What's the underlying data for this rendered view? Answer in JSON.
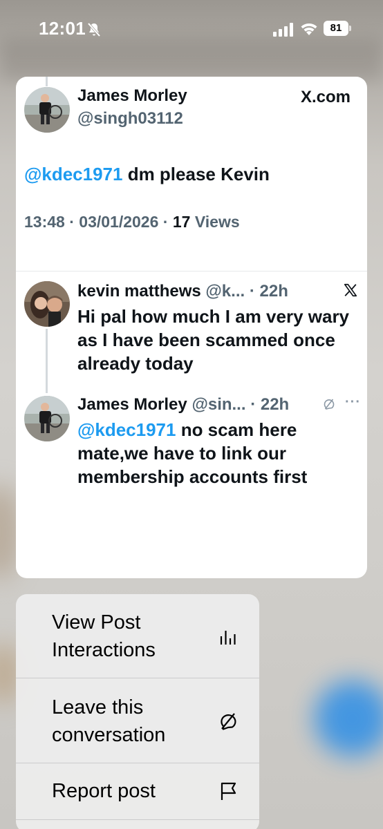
{
  "status_bar": {
    "time": "12:01",
    "battery": "81",
    "icons": [
      "bell-slash-icon",
      "cellular-signal-icon",
      "wifi-icon",
      "battery-icon"
    ]
  },
  "preview": {
    "main_post": {
      "author_name": "James Morley",
      "author_handle": "@singh03112",
      "source": "X.com",
      "mention": "@kdec1971",
      "text": " dm please Kevin",
      "time": "13:48",
      "date": "03/01/2026",
      "views_count": "17",
      "views_label": "Views"
    },
    "replies": [
      {
        "author_name": "kevin matthews",
        "handle_truncated": "@k...",
        "age": "22h",
        "text": "Hi pal how much I am very wary as I have been scammed once already today",
        "icon": "x-logo-icon"
      },
      {
        "author_name": "James Morley",
        "handle_truncated": "@sin...",
        "age": "22h",
        "mention": "@kdec1971",
        "text": " no scam here mate,we have to link our membership accounts first",
        "icons": [
          "muted-conversation-icon",
          "more-dots-icon"
        ]
      }
    ]
  },
  "menu": {
    "items": [
      {
        "label": "View Post Interactions",
        "icon": "bar-chart-icon"
      },
      {
        "label": "Leave this conversation",
        "icon": "leave-conversation-icon"
      },
      {
        "label": "Report post",
        "icon": "flag-icon"
      }
    ]
  },
  "colors": {
    "link": "#1d9bf0",
    "secondary_text": "#536471",
    "primary_text": "#0f1419",
    "fab_blue": "#2d8ee6"
  }
}
